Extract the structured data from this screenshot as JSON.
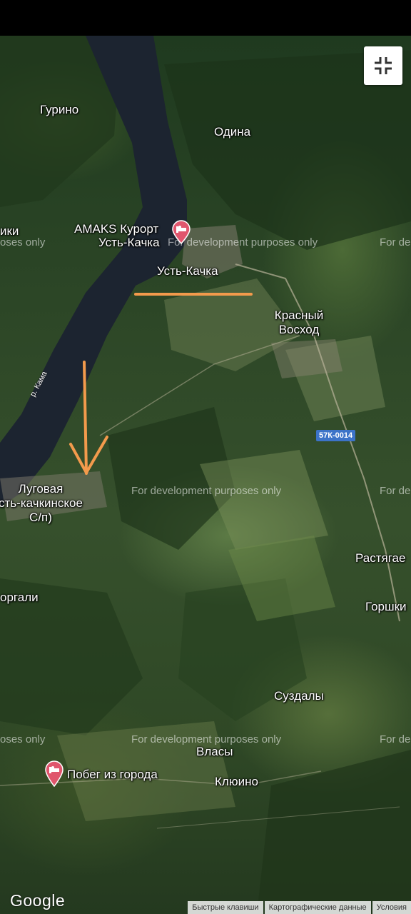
{
  "colors": {
    "annotation": "#f39a4c",
    "river": "#1c2430",
    "pin": "#e0566d",
    "route_shield": "#3c73c8"
  },
  "controls": {
    "fullscreen_icon": "exit-fullscreen-icon"
  },
  "places": {
    "gurino": "Гурино",
    "odina": "Одина",
    "amaks_resort": "AMAKS Курорт",
    "ust_kachka_resort": "Усть-Качка",
    "ust_kachka": "Усть-Качка",
    "krasny_voskhod": "Красный\nВосход",
    "luzhki": "ики",
    "lugovaya": "Луговая\nсть-качкинское\nС/п)",
    "rastyagae": "Растягае",
    "borgali": "оргали",
    "gorshki": "Горшки",
    "suzdaly": "Суздалы",
    "vlasy": "Власы",
    "kluino": "Клюино",
    "pobeg": "Побег из города"
  },
  "river": "р. Кама",
  "route": "57К-0014",
  "watermarks": {
    "text_full": "For development purposes only",
    "text_right": "For de",
    "text_left": "oses only"
  },
  "branding": {
    "google": "Google"
  },
  "attribution": {
    "shortcuts": "Быстрые клавиши",
    "map_data": "Картографические данные",
    "terms": "Условия"
  }
}
